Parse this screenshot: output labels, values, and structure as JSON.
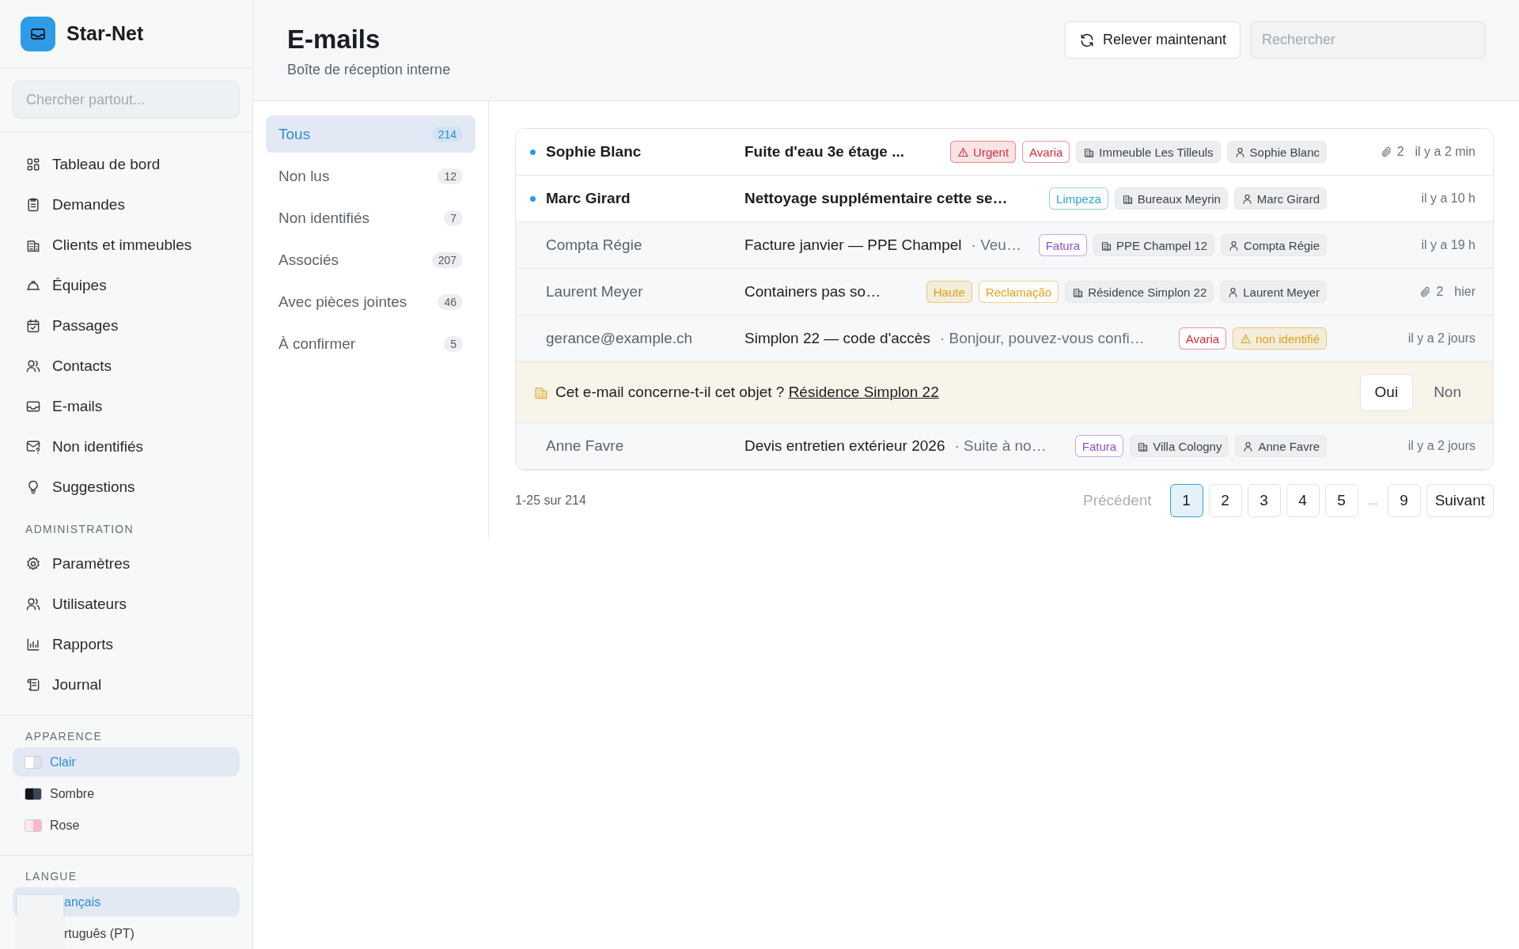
{
  "app": {
    "name": "Star-Net"
  },
  "sidebar": {
    "search": {
      "placeholder": "Chercher partout..."
    },
    "items": [
      {
        "label": "Tableau de bord"
      },
      {
        "label": "Demandes"
      },
      {
        "label": "Clients et immeubles"
      },
      {
        "label": "Équipes"
      },
      {
        "label": "Passages"
      },
      {
        "label": "Contacts"
      },
      {
        "label": "E-mails"
      },
      {
        "label": "Non identifiés"
      },
      {
        "label": "Suggestions"
      }
    ],
    "admin": {
      "title": "ADMINISTRATION",
      "items": [
        {
          "label": "Paramètres"
        },
        {
          "label": "Utilisateurs"
        },
        {
          "label": "Rapports"
        },
        {
          "label": "Journal"
        }
      ]
    },
    "appearance": {
      "title": "APPARENCE",
      "items": [
        {
          "label": "Clair",
          "selected": true,
          "swatch": [
            {
              "color": "#ffffff"
            },
            {
              "color": "#dfe3e8"
            }
          ]
        },
        {
          "label": "Sombre",
          "selected": false,
          "swatch": [
            {
              "color": "#111418"
            },
            {
              "color": "#3c4654"
            }
          ]
        },
        {
          "label": "Rose",
          "selected": false,
          "swatch": [
            {
              "color": "#fde8ee"
            },
            {
              "color": "#f7b9c9"
            }
          ]
        }
      ]
    },
    "language": {
      "title": "LANGUE",
      "items": [
        {
          "label": "ançais",
          "selected": true
        },
        {
          "label": "rtuguês (PT)",
          "selected": false
        }
      ]
    }
  },
  "header": {
    "title": "E-mails",
    "subtitle": "Boîte de réception interne",
    "refresh_button": "Relever maintenant",
    "search": {
      "placeholder": "Rechercher"
    }
  },
  "filters": [
    {
      "label": "Tous",
      "count": "214",
      "selected": true
    },
    {
      "label": "Non lus",
      "count": "12",
      "selected": false
    },
    {
      "label": "Non identifiés",
      "count": "7",
      "selected": false
    },
    {
      "label": "Associés",
      "count": "207",
      "selected": false
    },
    {
      "label": "Avec pièces jointes",
      "count": "46",
      "selected": false
    },
    {
      "label": "À confirmer",
      "count": "5",
      "selected": false
    }
  ],
  "emails": [
    {
      "kind": "email",
      "unread": true,
      "sender": "Sophie Blanc",
      "subject": "Fuite d'eau 3e étage ...",
      "tags": [
        {
          "kind": "alert",
          "label": "Urgent",
          "color": "#d92d3a"
        },
        {
          "kind": "category",
          "label": "Avaria",
          "color": "#d92d3a"
        },
        {
          "kind": "building",
          "label": "Immeuble Les Tilleuls"
        },
        {
          "kind": "person",
          "label": "Sophie Blanc"
        }
      ],
      "attachments": "2",
      "time": "il y a 2 min"
    },
    {
      "kind": "email",
      "unread": true,
      "sender": "Marc Girard",
      "subject": "Nettoyage supplémentaire cette se…",
      "tags": [
        {
          "kind": "category",
          "label": "Limpeza",
          "color": "#2aa5d0"
        },
        {
          "kind": "building",
          "label": "Bureaux Meyrin"
        },
        {
          "kind": "person",
          "label": "Marc Girard"
        }
      ],
      "time": "il y a 10 h"
    },
    {
      "kind": "email",
      "unread": false,
      "sender": "Compta Régie",
      "subject": "Facture janvier — PPE Champel",
      "preview": "· Veu…",
      "tags": [
        {
          "kind": "category",
          "label": "Fatura",
          "color": "#8a4fd0"
        },
        {
          "kind": "building",
          "label": "PPE Champel 12"
        },
        {
          "kind": "person",
          "label": "Compta Régie"
        }
      ],
      "time": "il y a 19 h"
    },
    {
      "kind": "email",
      "unread": false,
      "sender": "Laurent Meyer",
      "subject": "Containers pas so…",
      "tags": [
        {
          "kind": "priority",
          "label": "Haute",
          "color": "#e0a21b"
        },
        {
          "kind": "category",
          "label": "Reclamação",
          "color": "#e0a21b"
        },
        {
          "kind": "building",
          "label": "Résidence Simplon 22"
        },
        {
          "kind": "person",
          "label": "Laurent Meyer"
        }
      ],
      "attachments": "2",
      "time": "hier"
    },
    {
      "kind": "email",
      "unread": false,
      "sender": "gerance@example.ch",
      "subject": "Simplon 22 — code d'accès",
      "preview": "· Bonjour, pouvez-vous confi…",
      "tags": [
        {
          "kind": "category",
          "label": "Avaria",
          "color": "#d92d3a"
        },
        {
          "kind": "alert",
          "label": "non identifié",
          "color": "#e0a21b"
        }
      ],
      "time": "il y a 2 jours"
    },
    {
      "kind": "suggestion",
      "question": "Cet e-mail concerne-t-il cet objet ?",
      "link": "Résidence Simplon 22",
      "confirm": "Oui",
      "reject": "Non"
    },
    {
      "kind": "email",
      "unread": false,
      "sender": "Anne Favre",
      "subject": "Devis entretien extérieur 2026",
      "preview": "· Suite à no…",
      "tags": [
        {
          "kind": "category",
          "label": "Fatura",
          "color": "#8a4fd0"
        },
        {
          "kind": "building",
          "label": "Villa Cologny"
        },
        {
          "kind": "person",
          "label": "Anne Favre"
        }
      ],
      "time": "il y a 2 jours"
    }
  ],
  "pagination": {
    "summary": "1-25 sur 214",
    "previous": {
      "label": "Précédent",
      "disabled": true
    },
    "pages": [
      {
        "kind": "page",
        "label": "1",
        "selected": true
      },
      {
        "kind": "page",
        "label": "2",
        "selected": false
      },
      {
        "kind": "page",
        "label": "3",
        "selected": false
      },
      {
        "kind": "page",
        "label": "4",
        "selected": false
      },
      {
        "kind": "page",
        "label": "5",
        "selected": false
      },
      {
        "kind": "gap",
        "label": "…"
      },
      {
        "kind": "page",
        "label": "9",
        "selected": false
      }
    ],
    "next": {
      "label": "Suivant",
      "disabled": false
    }
  }
}
